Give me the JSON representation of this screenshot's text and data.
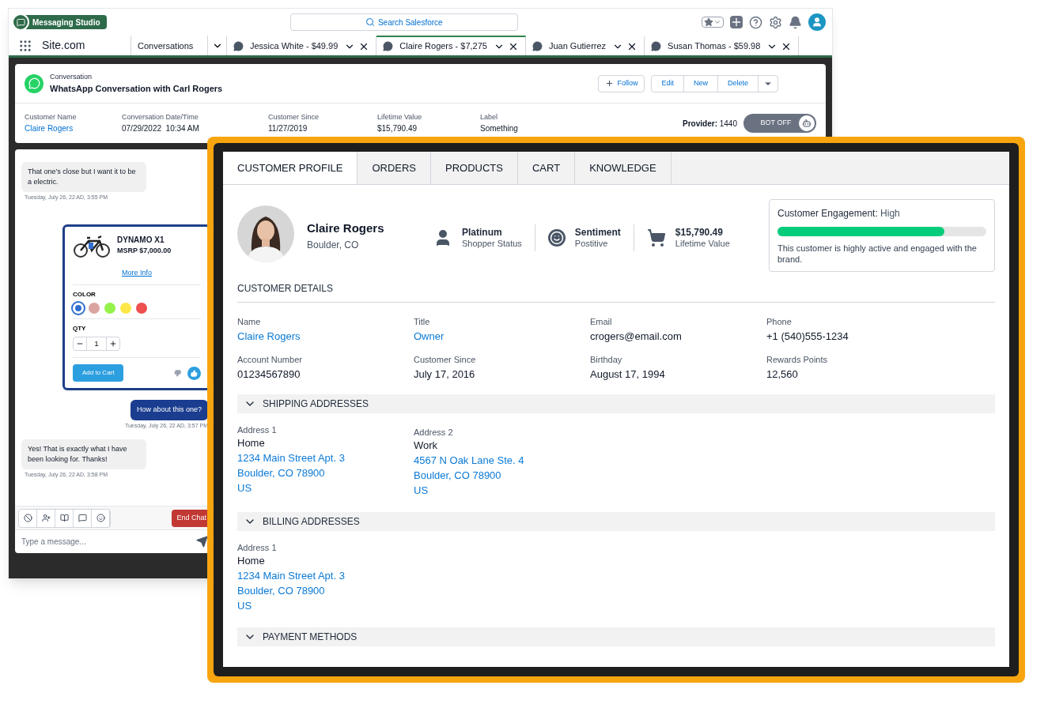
{
  "app": {
    "name": "Messaging Studio",
    "search_placeholder": "Search Salesforce",
    "site": "Site.com"
  },
  "workspace_tabs": [
    {
      "label": "Conversations",
      "kind": "nav",
      "selected": false
    },
    {
      "label": "Jessica White - $49.99",
      "kind": "record",
      "selected": false
    },
    {
      "label": "Claire Rogers - $7,275",
      "kind": "record",
      "selected": true
    },
    {
      "label": "Juan Gutierrez",
      "kind": "record",
      "selected": false
    },
    {
      "label": "Susan Thomas - $59.98",
      "kind": "record",
      "selected": false
    }
  ],
  "record": {
    "type": "Conversation",
    "title": "WhatsApp Conversation with Carl Rogers",
    "actions": [
      "Follow",
      "Edit",
      "New",
      "Delete"
    ],
    "fields": [
      {
        "label": "Customer Name",
        "value": "Claire Rogers",
        "link": true
      },
      {
        "label": "Conversation Date/Time",
        "value": "07/29/2022  10:34 AM",
        "link": false
      },
      {
        "label": "Customer Since",
        "value": "11/27/2019",
        "link": false
      },
      {
        "label": "Lifetime Value",
        "value": "$15,790.49",
        "link": false
      },
      {
        "label": "Label",
        "value": "Something",
        "link": false
      }
    ],
    "provider_label": "Provider:",
    "provider_value": "1440",
    "bot_toggle": {
      "label": "BOT OFF",
      "on": false
    }
  },
  "chat": {
    "messages": [
      {
        "kind": "in",
        "text": "That one’s close but I want it to be a electric.",
        "time": "Tuesday, July 26, 22 AD, 3:55 PM"
      },
      {
        "kind": "product",
        "name": "DYNAMO X1",
        "price": "MSRP $7,000.00",
        "link": "More Info",
        "color_label": "COLOR",
        "colors": [
          {
            "color": "#2f6fd0",
            "selected": true
          },
          {
            "color": "#dba3a0",
            "selected": false
          },
          {
            "color": "#94f24a",
            "selected": false
          },
          {
            "color": "#fde84a",
            "selected": false
          },
          {
            "color": "#ee4f4f",
            "selected": false
          }
        ],
        "qty_label": "QTY",
        "qty": "1",
        "cta": "Add to Cart",
        "liked": true
      },
      {
        "kind": "out",
        "text": "How about this one?",
        "time": "Tuesday, July 26, 22 AD, 3:57 PM"
      },
      {
        "kind": "in",
        "text": "Yes! That is exactly what I have been  looking for. Thanks!",
        "time": "Tuesday, July 26, 22 AD, 3:58 PM"
      }
    ],
    "end_button": "End Chat",
    "input_placeholder": "Type a message..."
  },
  "profile": {
    "tabs": [
      {
        "label": "CUSTOMER PROFILE",
        "selected": true
      },
      {
        "label": "ORDERS",
        "selected": false
      },
      {
        "label": "PRODUCTS",
        "selected": false
      },
      {
        "label": "CART",
        "selected": false
      },
      {
        "label": "KNOWLEDGE",
        "selected": false
      }
    ],
    "name": "Claire Rogers",
    "location": "Boulder, CO",
    "stats": [
      {
        "kind": "person",
        "title": "Platinum",
        "subtitle": "Shopper Status"
      },
      {
        "kind": "smile",
        "title": "Sentiment",
        "subtitle": "Postitive"
      },
      {
        "kind": "cart",
        "title": "$15,790.49",
        "subtitle": "Lifetime Value"
      }
    ],
    "engagement": {
      "label": "Customer Engagement:",
      "value": "High",
      "level": 0.8,
      "note": "This customer is highly active and engaged with the brand."
    },
    "details_title": "CUSTOMER DETAILS",
    "details": [
      {
        "label": "Name",
        "value": "Claire Rogers",
        "link": true
      },
      {
        "label": "Title",
        "value": "Owner",
        "link": true
      },
      {
        "label": "Email",
        "value": "crogers@email.com",
        "link": false
      },
      {
        "label": "Phone",
        "value": "+1 (540)555-1234",
        "link": false
      },
      {
        "label": "Account Number",
        "value": "01234567890",
        "link": false
      },
      {
        "label": "Customer Since",
        "value": "July 17, 2016",
        "link": false
      },
      {
        "label": "Birthday",
        "value": "August 17, 1994",
        "link": false
      },
      {
        "label": "Rewards Points",
        "value": "12,560",
        "link": false
      }
    ],
    "sections": [
      {
        "title": "SHIPPING ADDRESSES",
        "expanded": true,
        "addresses": [
          {
            "label": "Address 1",
            "type": "Home",
            "lines": [
              "1234 Main Street Apt. 3",
              "Boulder, CO 78900",
              "US"
            ]
          },
          {
            "label": "Address 2",
            "type": "Work",
            "lines": [
              "4567 N Oak Lane Ste. 4",
              "Boulder, CO 78900",
              "US"
            ]
          }
        ]
      },
      {
        "title": "BILLING ADDRESSES",
        "expanded": true,
        "addresses": [
          {
            "label": "Address 1",
            "type": "Home",
            "lines": [
              "1234 Main Street Apt. 3",
              "Boulder, CO 78900",
              "US"
            ]
          }
        ]
      },
      {
        "title": "PAYMENT METHODS",
        "expanded": true
      }
    ]
  }
}
